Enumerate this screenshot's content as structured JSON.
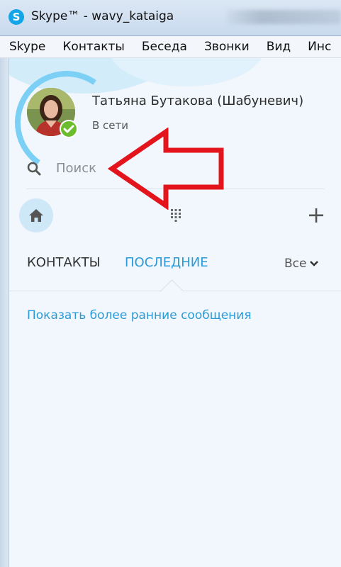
{
  "window": {
    "title": "Skype™ - wavy_kataiga",
    "icon": "skype-logo-icon"
  },
  "menubar": {
    "items": [
      "Skype",
      "Контакты",
      "Беседа",
      "Звонки",
      "Вид",
      "Инс"
    ]
  },
  "profile": {
    "name": "Татьяна Бутакова (Шабуневич)",
    "status": "В сети",
    "status_color": "#6bbd2d"
  },
  "search": {
    "placeholder": "Поиск",
    "value": ""
  },
  "toolbar": {
    "home_icon": "home-icon",
    "dialpad_icon": "dialpad-icon",
    "add_label": "+"
  },
  "tabs": {
    "contacts_label": "КОНТАКТЫ",
    "recent_label": "ПОСЛЕДНИЕ",
    "active": "recent",
    "filter_label": "Все"
  },
  "recent": {
    "show_earlier_link": "Показать более ранние сообщения"
  },
  "colors": {
    "accent": "#2a9bd8",
    "background": "#f1f7fc",
    "annotation": "#e3141b"
  }
}
